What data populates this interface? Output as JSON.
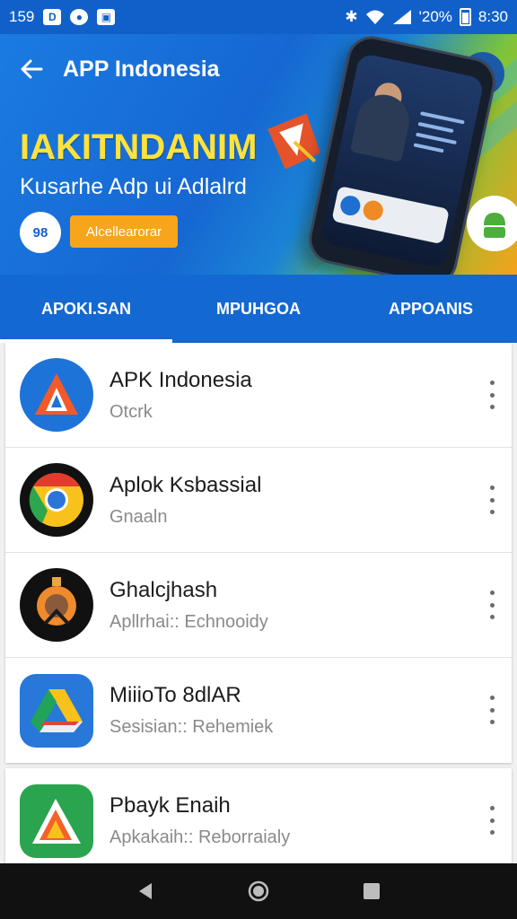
{
  "status_bar": {
    "time_left": "159",
    "battery": "'20%",
    "time_right": "8:30"
  },
  "header": {
    "title": "APP Indonesia"
  },
  "hero": {
    "headline": "IAKITNDANIM",
    "subtitle": "Kusarhe Adp ui Adlalrd",
    "logo_text": "98",
    "cta_label": "Alcellearorar"
  },
  "tabs": [
    {
      "label": "APOKI.SAN",
      "active": true
    },
    {
      "label": "MPUHGOA",
      "active": false
    },
    {
      "label": "APPOANIS",
      "active": false
    }
  ],
  "apps": [
    {
      "title": "APK Indonesia",
      "subtitle": "Otcrk",
      "icon": "apk-icon"
    },
    {
      "title": "Aplok Ksbassial",
      "subtitle": "Gnaaln",
      "icon": "chrome-icon"
    },
    {
      "title": "Ghalcjhash",
      "subtitle": "Apllrhai:: Echnooidy",
      "icon": "orange-badge-icon"
    },
    {
      "title": "MiiioTo 8dlAR",
      "subtitle": "Sesisian:: Rehemiek",
      "icon": "drive-icon"
    },
    {
      "title": "Pbayk Enaih",
      "subtitle": "Apkakaih:: Reborraialy",
      "icon": "green-triangle-icon"
    }
  ],
  "colors": {
    "primary": "#1468d1",
    "accent_yellow": "#ffe23a",
    "cta_orange": "#f7a51b"
  }
}
